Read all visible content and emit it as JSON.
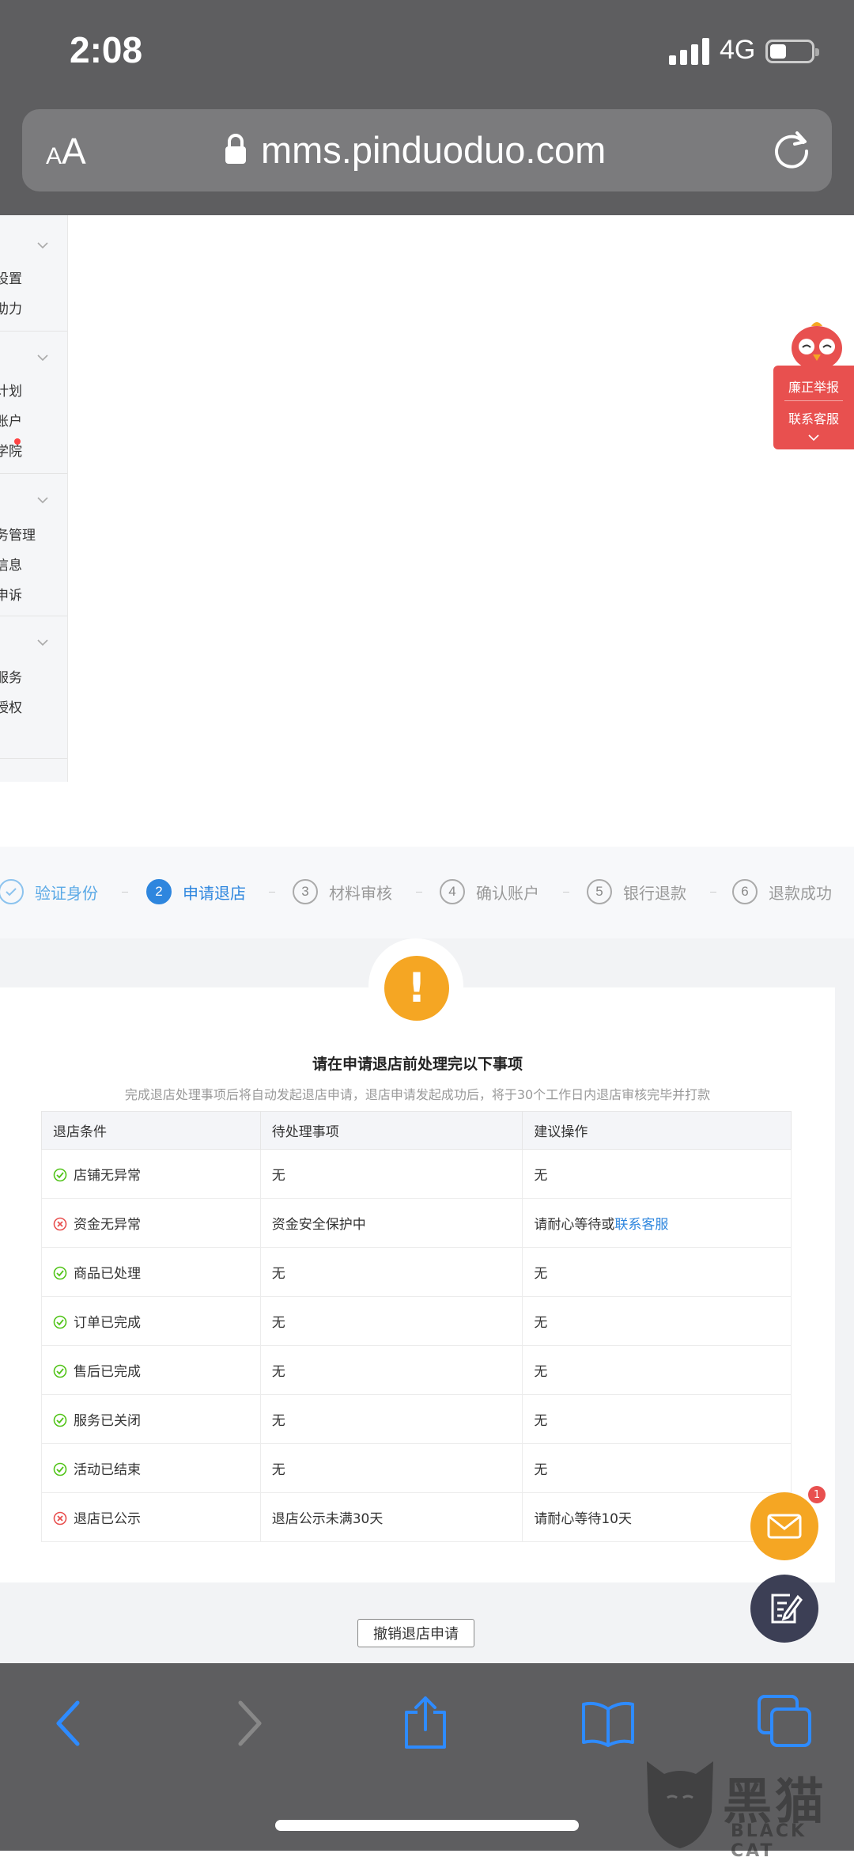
{
  "status_bar": {
    "time": "2:08",
    "network": "4G"
  },
  "browser": {
    "text_size_label": "AA",
    "url": "mms.pinduoduo.com"
  },
  "sidebar": {
    "items": [
      "设置",
      "助力",
      "计划",
      "账户",
      "学院",
      "务管理",
      "信息",
      "申诉",
      "服务",
      "授权"
    ]
  },
  "float_panel": {
    "report": "廉正举报",
    "service": "联系客服"
  },
  "steps": [
    {
      "num": "1",
      "label": "验证身份",
      "state": "done"
    },
    {
      "num": "2",
      "label": "申请退店",
      "state": "active"
    },
    {
      "num": "3",
      "label": "材料审核",
      "state": "pending"
    },
    {
      "num": "4",
      "label": "确认账户",
      "state": "pending"
    },
    {
      "num": "5",
      "label": "银行退款",
      "state": "pending"
    },
    {
      "num": "6",
      "label": "退款成功",
      "state": "pending"
    }
  ],
  "notice": {
    "title": "请在申请退店前处理完以下事项",
    "subtitle": "完成退店处理事项后将自动发起退店申请，退店申请发起成功后，将于30个工作日内退店审核完毕并打款"
  },
  "table": {
    "headers": [
      "退店条件",
      "待处理事项",
      "建议操作"
    ],
    "rows": [
      {
        "status": "ok",
        "condition": "店铺无异常",
        "pending": "无",
        "action": "无",
        "link": ""
      },
      {
        "status": "fail",
        "condition": "资金无异常",
        "pending": "资金安全保护中",
        "action": "请耐心等待或",
        "link": "联系客服"
      },
      {
        "status": "ok",
        "condition": "商品已处理",
        "pending": "无",
        "action": "无",
        "link": ""
      },
      {
        "status": "ok",
        "condition": "订单已完成",
        "pending": "无",
        "action": "无",
        "link": ""
      },
      {
        "status": "ok",
        "condition": "售后已完成",
        "pending": "无",
        "action": "无",
        "link": ""
      },
      {
        "status": "ok",
        "condition": "服务已关闭",
        "pending": "无",
        "action": "无",
        "link": ""
      },
      {
        "status": "ok",
        "condition": "活动已结束",
        "pending": "无",
        "action": "无",
        "link": ""
      },
      {
        "status": "fail",
        "condition": "退店已公示",
        "pending": "退店公示未满30天",
        "action": "请耐心等待10天",
        "link": ""
      }
    ]
  },
  "cancel_button": "撤销退店申请",
  "mail_badge": "1",
  "watermark": {
    "cn": "黑猫",
    "en": "BLACK CAT"
  },
  "colors": {
    "accent": "#2e86de",
    "warning": "#f5a623",
    "success": "#52c41a",
    "error": "#e8504f",
    "chrome": "#5e5e60"
  }
}
